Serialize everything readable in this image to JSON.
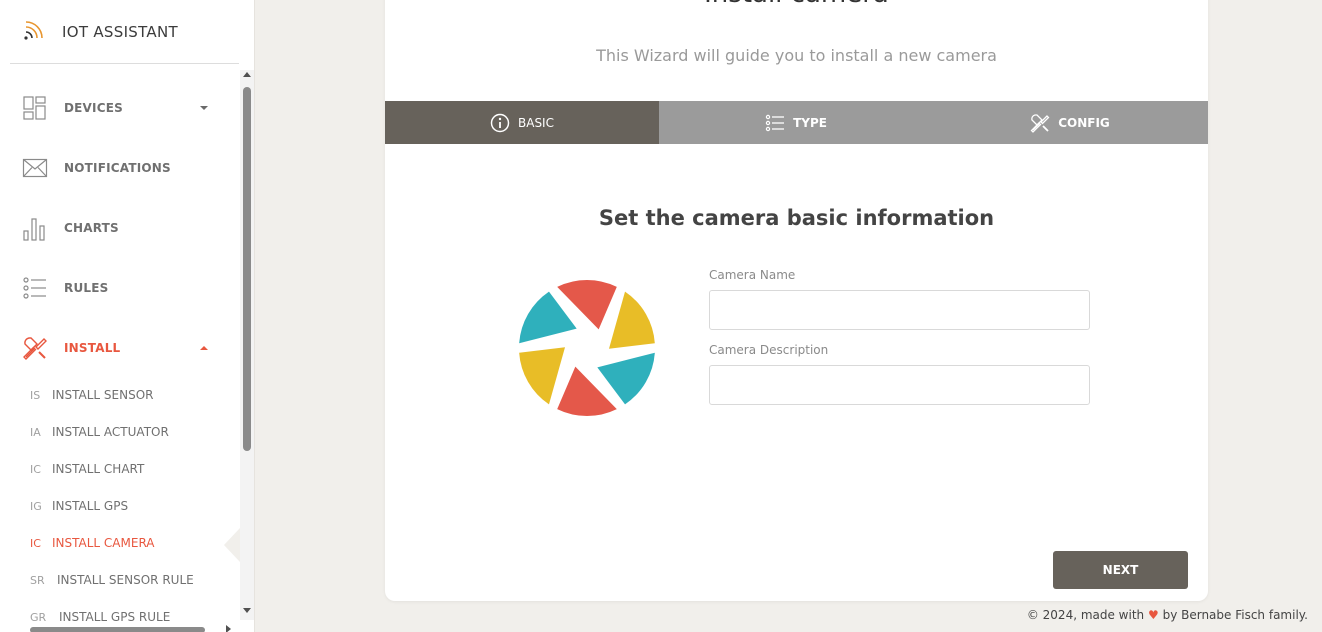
{
  "brand": {
    "title": "IOT ASSISTANT",
    "accent": "#e8962f"
  },
  "sidebar": {
    "items": [
      {
        "label": "DEVICES",
        "icon": "devices-icon",
        "caret": "down"
      },
      {
        "label": "NOTIFICATIONS",
        "icon": "envelope-icon"
      },
      {
        "label": "CHARTS",
        "icon": "bar-chart-icon"
      },
      {
        "label": "RULES",
        "icon": "list-icon"
      },
      {
        "label": "INSTALL",
        "icon": "tools-icon",
        "caret": "up",
        "active": true
      }
    ],
    "subitems": [
      {
        "abbr": "IS",
        "label": "INSTALL SENSOR"
      },
      {
        "abbr": "IA",
        "label": "INSTALL ACTUATOR"
      },
      {
        "abbr": "IC",
        "label": "INSTALL CHART"
      },
      {
        "abbr": "IG",
        "label": "INSTALL GPS"
      },
      {
        "abbr": "IC",
        "label": "INSTALL CAMERA",
        "active": true
      },
      {
        "abbr": "SR",
        "label": "INSTALL SENSOR RULE"
      },
      {
        "abbr": "GR",
        "label": "INSTALL GPS RULE"
      }
    ]
  },
  "wizard": {
    "title": "Install camera",
    "subtitle": "This Wizard will guide you to install a new camera",
    "tabs": [
      {
        "label": "BASIC",
        "icon": "info-circle-icon",
        "active": true
      },
      {
        "label": "TYPE",
        "icon": "list-icon"
      },
      {
        "label": "CONFIG",
        "icon": "tools-icon"
      }
    ],
    "step_title": "Set the camera basic information",
    "fields": {
      "name_label": "Camera Name",
      "name_value": "",
      "description_label": "Camera Description",
      "description_value": ""
    },
    "next_label": "NEXT"
  },
  "footer": {
    "prefix": "© 2024, made with",
    "suffix": "by Bernabe Fisch family."
  },
  "colors": {
    "accent": "#e8573f",
    "tab_active": "#67625b",
    "tab_inactive": "#9b9b9b",
    "aperture_red": "#e4584a",
    "aperture_yellow": "#e8bd27",
    "aperture_teal": "#2fb0bc"
  }
}
